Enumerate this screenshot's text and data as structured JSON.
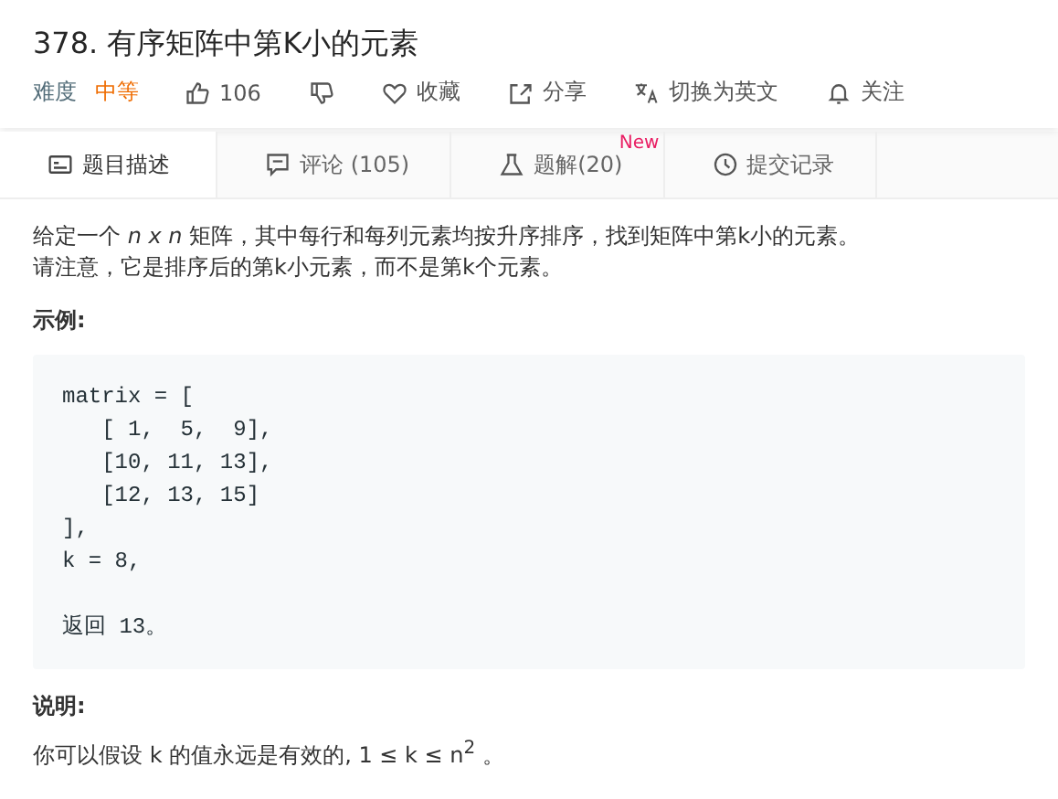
{
  "title": "378. 有序矩阵中第K小的元素",
  "meta": {
    "difficulty_label": "难度",
    "difficulty": "中等",
    "actions": [
      {
        "kind": "like",
        "label": "106"
      },
      {
        "kind": "dislike"
      },
      {
        "kind": "favorite",
        "label": "收藏"
      },
      {
        "kind": "share",
        "label": "分享"
      },
      {
        "kind": "translate",
        "label": "切换为英文"
      },
      {
        "kind": "follow",
        "label": "关注"
      }
    ]
  },
  "tabs": [
    {
      "kind": "description",
      "label": "题目描述",
      "selected": true
    },
    {
      "kind": "comments",
      "label": "评论 (105)",
      "selected": false
    },
    {
      "kind": "solutions",
      "label": "题解(20)",
      "badge": "New",
      "selected": false
    },
    {
      "kind": "submissions",
      "label": "提交记录",
      "selected": false
    }
  ],
  "description": [
    "给定一个 *n x n* 矩阵，其中每行和每列元素均按升序排序，找到矩阵中第k小的元素。",
    "请注意，它是排序后的第k小元素，而不是第k个元素。"
  ],
  "example_heading": "示例:",
  "example_code": "matrix = [\n   [ 1,  5,  9],\n   [10, 11, 13],\n   [12, 13, 15]\n],\nk = 8,\n\n返回 13。",
  "note_heading": "说明:",
  "note": "你可以假设 k 的值永远是有效的, 1 ≤ k ≤ n$^{2}$ 。"
}
